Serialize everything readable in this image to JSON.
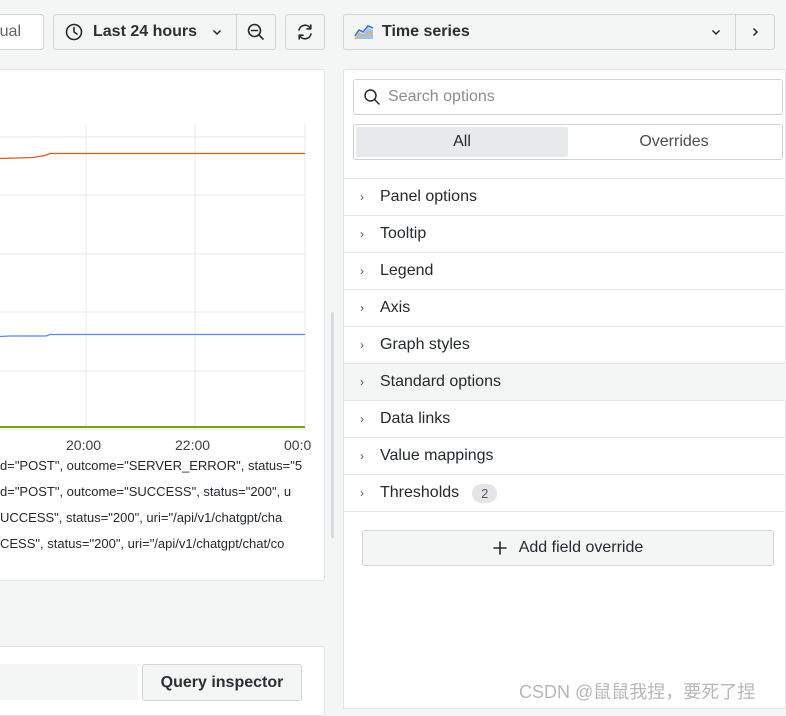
{
  "toolbar": {
    "refresh_mode_fragment": "ual",
    "time_range_label": "Last 24 hours",
    "visualization_label": "Time series"
  },
  "graph": {
    "x_ticks": [
      "20:00",
      "22:00",
      "00:0"
    ],
    "series_colors": [
      "#e05b18",
      "#5a88e6",
      "#76a513"
    ],
    "legend": [
      "d=\"POST\", outcome=\"SERVER_ERROR\", status=\"5",
      "d=\"POST\", outcome=\"SUCCESS\", status=\"200\", u",
      "UCCESS\", status=\"200\", uri=\"/api/v1/chatgpt/cha",
      "CESS\", status=\"200\", uri=\"/api/v1/chatgpt/chat/co"
    ]
  },
  "query": {
    "inspector_label": "Query inspector"
  },
  "options_pane": {
    "search_placeholder": "Search options",
    "tabs": [
      {
        "label": "All",
        "active": true
      },
      {
        "label": "Overrides",
        "active": false
      }
    ],
    "sections": [
      {
        "label": "Panel options"
      },
      {
        "label": "Tooltip"
      },
      {
        "label": "Legend"
      },
      {
        "label": "Axis"
      },
      {
        "label": "Graph styles"
      },
      {
        "label": "Standard options"
      },
      {
        "label": "Data links"
      },
      {
        "label": "Value mappings"
      },
      {
        "label": "Thresholds",
        "badge": "2"
      }
    ],
    "add_override_label": "Add field override"
  },
  "watermark": "CSDN @鼠鼠我捏，要死了捏"
}
